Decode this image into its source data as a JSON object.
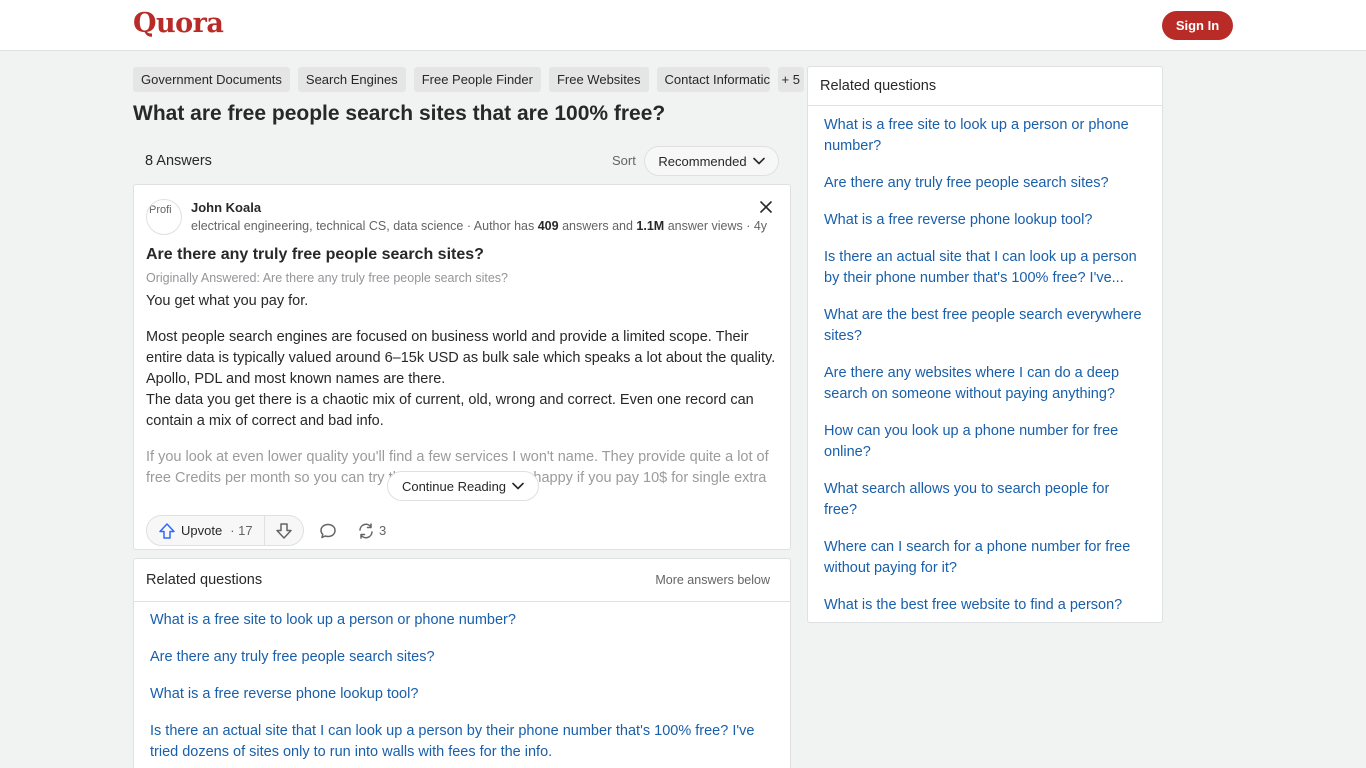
{
  "header": {
    "logo": "Quora",
    "signin_label": "Sign In",
    "brand_color": "#b92b27"
  },
  "topics": [
    "Government Documents",
    "Search Engines",
    "Free People Finder",
    "Free Websites",
    "Contact Informatic",
    "+ 5"
  ],
  "question": {
    "title": "What are free people search sites that are 100% free?",
    "answers_count": "8 Answers",
    "sort_label": "Sort",
    "sort_value": "Recommended"
  },
  "answer": {
    "avatar_alt": "Profi",
    "author_name": "John Koala",
    "credential": "electrical engineering, technical CS, data science · Author has ",
    "answers_num": "409",
    "answers_mid": " answers and ",
    "views_num": "1.1M",
    "views_tail": " answer views · 4y",
    "question": "Are there any truly free people search sites?",
    "originally_answered": "Originally Answered: Are there any truly free people search sites?",
    "paragraphs": [
      "You get what you pay for.",
      "Most people search engines are focused on business world and provide a limited scope. Their entire data is typically valued around 6–15k USD as bulk sale which speaks a lot about the quality. Apollo, PDL and most known names are there.\nThe data you get there is a chaotic mix of current, old, wrong and correct. Even one record can contain a mix of correct and bad info.",
      "If you look at even lower quality you'll find a few services I won't name. They provide quite a lot of free Credits per month so you can try them out. They will be happy if you pay 10$ for single extra"
    ],
    "continue_label": "Continue Reading",
    "upvote_label": "Upvote",
    "upvote_count": "17",
    "share_count": "3"
  },
  "related_inline": {
    "title": "Related questions",
    "more_label": "More answers below",
    "items": [
      "What is a free site to look up a person or phone number?",
      "Are there any truly free people search sites?",
      "What is a free reverse phone lookup tool?",
      "Is there an actual site that I can look up a person by their phone number that's 100% free? I've tried dozens of sites only to run into walls with fees for the info."
    ]
  },
  "sidebar": {
    "title": "Related questions",
    "items": [
      "What is a free site to look up a person or phone number?",
      "Are there any truly free people search sites?",
      "What is a free reverse phone lookup tool?",
      "Is there an actual site that I can look up a person by their phone number that's 100% free? I've...",
      "What are the best free people search everywhere sites?",
      "Are there any websites where I can do a deep search on someone without paying anything?",
      "How can you look up a phone number for free online?",
      "What search allows you to search people for free?",
      "Where can I search for a phone number for free without paying for it?",
      "What is the best free website to find a person?"
    ]
  }
}
